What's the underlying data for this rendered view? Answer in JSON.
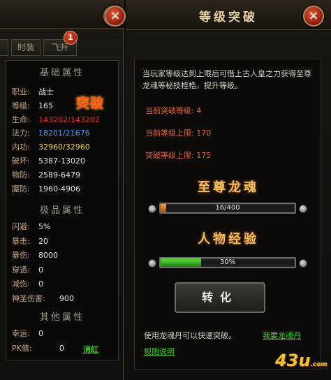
{
  "left_panel": {
    "tabs": [
      "时装",
      "飞升"
    ],
    "badge_count": "1",
    "basic_header": "基础属性",
    "breakthrough_stamp": "突破",
    "basic_stats": [
      {
        "label": "职业:",
        "value": "战士",
        "color": "#e8e4da"
      },
      {
        "label": "等级:",
        "value": "165",
        "color": "#e8e4da"
      },
      {
        "label": "生命:",
        "value": "143202/143202",
        "color": "#e0302a"
      },
      {
        "label": "法力:",
        "value": "18201/21676",
        "color": "#3aa0ff"
      },
      {
        "label": "内功:",
        "value": "32960/32960",
        "color": "#f0d838"
      },
      {
        "label": "破坏:",
        "value": "5387-13020",
        "color": "#e8e4da"
      },
      {
        "label": "物防:",
        "value": "2589-6479",
        "color": "#e8e4da"
      },
      {
        "label": "魔防:",
        "value": "1960-4906",
        "color": "#e8e4da"
      }
    ],
    "premium_header": "极品属性",
    "premium_stats": [
      {
        "label": "闪避:",
        "value": "5%"
      },
      {
        "label": "暴击:",
        "value": "20"
      },
      {
        "label": "暴伤:",
        "value": "8000"
      },
      {
        "label": "穿透:",
        "value": "0"
      },
      {
        "label": "减伤:",
        "value": "0"
      },
      {
        "label": "神圣伤害:",
        "value": "900"
      }
    ],
    "other_header": "其他属性",
    "other_stats": [
      {
        "label": "幸运:",
        "value": "0"
      },
      {
        "label": "PK值:",
        "value": "0"
      }
    ],
    "clear_red_link": "消红"
  },
  "right_panel": {
    "title": "等级突破",
    "description": "当玩家等级达到上限后可借上古人皇之力获得至尊龙魂等秘技桎梏，提升等级。",
    "info": [
      {
        "label": "当前突破等级:",
        "value": "4"
      },
      {
        "label": "当前等级上限:",
        "value": "170"
      },
      {
        "label": "突破等级上限:",
        "value": "175"
      }
    ],
    "dragon_soul": {
      "title": "至尊龙魂",
      "text": "16/400",
      "current": 16,
      "max": 400
    },
    "experience": {
      "title": "人物经验",
      "text": "30%",
      "percent": 30
    },
    "convert_button": "转化",
    "hint": "使用龙魂丹可以快速突破。",
    "want_link": "我要龙魂丹",
    "rules_link": "规则说明"
  },
  "logo": {
    "main": "43u",
    "suffix": ".com"
  },
  "colors": {
    "accent_gold": "#f0c060",
    "link_green": "#40d020",
    "info_orange": "#d86838"
  }
}
